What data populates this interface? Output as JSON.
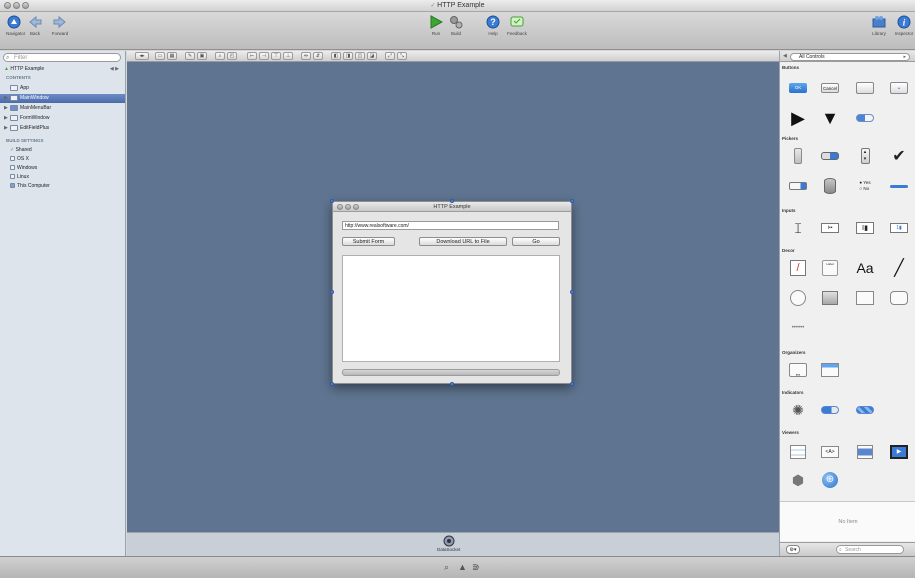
{
  "window": {
    "title": "HTTP Example"
  },
  "toolbar": {
    "navigator_label": "Navigator",
    "back_label": "Back",
    "forward_label": "Forward",
    "run_label": "Run",
    "build_label": "Build",
    "help_label": "Help",
    "feedback_label": "Feedback",
    "library_label": "Library",
    "inspector_label": "Inspector"
  },
  "sidebar": {
    "filter_placeholder": "Filter",
    "project": "HTTP Example",
    "contents_header": "CONTENTS",
    "items": [
      "App",
      "MainWindow",
      "MainMenuBar",
      "FormWindow",
      "EditFieldPlus"
    ],
    "build_header": "BUILD SETTINGS",
    "build_items": [
      "Shared",
      "OS X",
      "Windows",
      "Linux",
      "This Computer"
    ]
  },
  "designer": {
    "window_title": "HTTP Example",
    "url_value": "http://www.realsoftware.com/",
    "submit_label": "Submit Form",
    "download_label": "Download URL to File",
    "go_label": "Go"
  },
  "status": {
    "datasocket_label": "DataSocket"
  },
  "library": {
    "filter_label": "All Controls",
    "categories": {
      "buttons": "Buttons",
      "pickers": "Pickers",
      "inputs": "Inputs",
      "decor": "Decor",
      "organizers": "Organizers",
      "indicators": "Indicators",
      "viewers": "Viewers"
    },
    "ok_label": "OK",
    "cancel_label": "Cancel",
    "yes_label": "Yes",
    "no_label": "No",
    "aa_label": "Aa",
    "label_label": "Label",
    "html_label": "<A>",
    "no_item": "No Item",
    "search_placeholder": "Search"
  },
  "colors": {
    "canvas": "#5f7490",
    "sidebar": "#dde4ec",
    "selection": "#4a6aab",
    "accent_blue": "#3a7bd5",
    "run_green": "#3fa535"
  }
}
